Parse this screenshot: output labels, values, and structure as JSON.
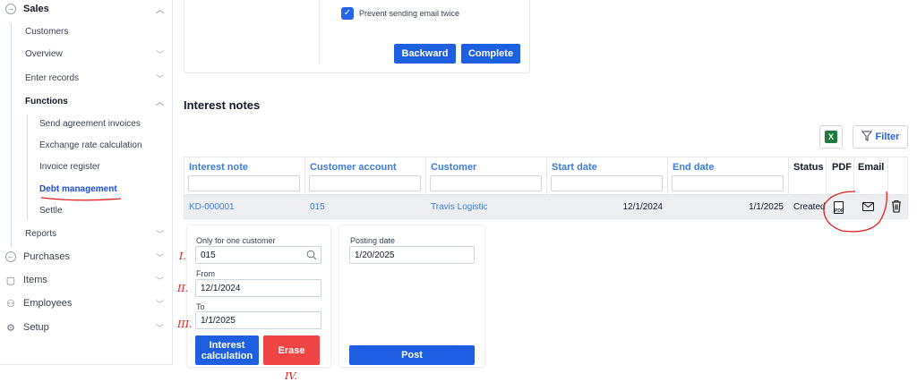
{
  "sidebar": {
    "sales": "Sales",
    "customers": "Customers",
    "overview": "Overview",
    "enter_records": "Enter records",
    "functions": "Functions",
    "send_agreement": "Send agreement invoices",
    "exchange_rate": "Exchange rate calculation",
    "invoice_register": "Invoice register",
    "debt_management": "Debt management",
    "settle": "Settle",
    "reports": "Reports",
    "purchases": "Purchases",
    "items": "Items",
    "employees": "Employees",
    "setup": "Setup"
  },
  "top_card": {
    "checkbox_label": "Prevent sending email twice",
    "backward": "Backward",
    "complete": "Complete"
  },
  "section_title": "Interest notes",
  "toolbar": {
    "filter": "Filter",
    "excel": "X"
  },
  "table": {
    "headers": [
      "Interest note",
      "Customer account",
      "Customer",
      "Start date",
      "End date",
      "Status",
      "PDF",
      "Email"
    ],
    "row": {
      "interest_note": "KD-000001",
      "customer_account": "015",
      "customer": "Travis Logistic",
      "start_date": "12/1/2024",
      "end_date": "1/1/2025",
      "status": "Created"
    }
  },
  "form": {
    "only_one_customer_label": "Only for one customer",
    "only_one_customer_value": "015",
    "from_label": "From",
    "from_value": "12/1/2024",
    "to_label": "To",
    "to_value": "1/1/2025",
    "interest_calc": "Interest calculation",
    "erase": "Erase",
    "posting_date_label": "Posting date",
    "posting_date_value": "1/20/2025",
    "post": "Post"
  },
  "annotations": [
    "I.",
    "II.",
    "III.",
    "IV."
  ]
}
